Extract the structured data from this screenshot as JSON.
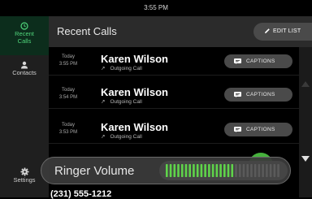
{
  "status_bar": {
    "time": "3:55 PM"
  },
  "sidebar": {
    "items": [
      {
        "label_line1": "Recent",
        "label_line2": "Calls",
        "icon": "clock-icon",
        "active": true
      },
      {
        "label": "Contacts",
        "icon": "person-icon"
      },
      {
        "label": "Settings",
        "icon": "gear-icon"
      }
    ]
  },
  "header": {
    "title": "Recent Calls",
    "edit_label": "EDIT LIST"
  },
  "calls": [
    {
      "day": "Today",
      "time": "3:55 PM",
      "name": "Karen Wilson",
      "direction": "Outgoing Call",
      "action": "CAPTIONS"
    },
    {
      "day": "Today",
      "time": "3:54 PM",
      "name": "Karen Wilson",
      "direction": "Outgoing Call",
      "action": "CAPTIONS"
    },
    {
      "day": "Today",
      "time": "3:53 PM",
      "name": "Karen Wilson",
      "direction": "Outgoing Call",
      "action": "CAPTIONS"
    }
  ],
  "partial_row": {
    "number": "(231) 555-1212"
  },
  "ringer": {
    "label": "Ringer Volume",
    "level_fraction": 0.6,
    "total_bars": 30
  },
  "colors": {
    "accent_green": "#4fd37a",
    "meter_green": "#5fd44a",
    "panel": "#3a3a3a"
  }
}
